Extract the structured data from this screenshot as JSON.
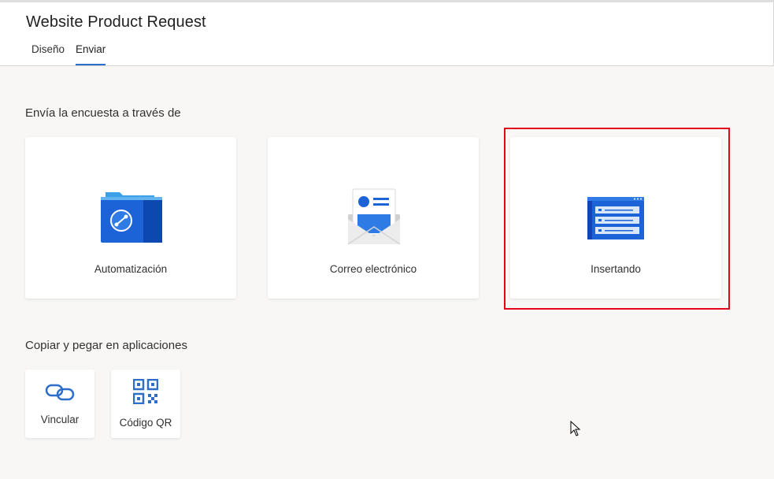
{
  "header": {
    "title": "Website Product Request",
    "tabs": [
      {
        "label": "Diseño",
        "active": false
      },
      {
        "label": "Enviar",
        "active": true
      }
    ]
  },
  "send_section": {
    "heading": "Envía la encuesta a través de",
    "cards": [
      {
        "label": "Automatización",
        "icon": "automation-folder-icon"
      },
      {
        "label": "Correo electrónico",
        "icon": "email-envelope-icon"
      },
      {
        "label": "Insertando",
        "icon": "embed-form-icon",
        "highlighted": true
      }
    ]
  },
  "copy_section": {
    "heading": "Copiar y pegar en aplicaciones",
    "cards": [
      {
        "label": "Vincular",
        "icon": "link-icon"
      },
      {
        "label": "Código QR",
        "icon": "qr-code-icon"
      }
    ]
  },
  "colors": {
    "accent": "#2f6ec8",
    "highlight_border": "#e3061b",
    "background": "#f8f7f6"
  }
}
